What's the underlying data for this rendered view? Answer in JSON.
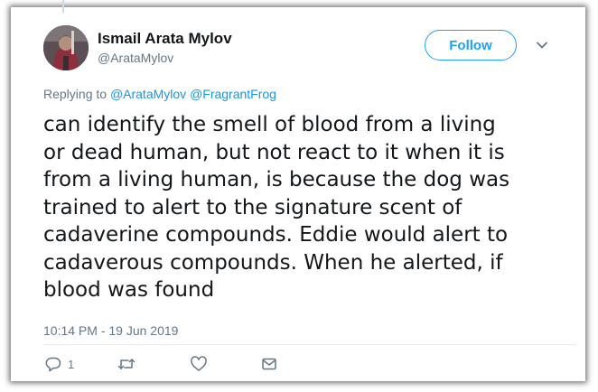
{
  "tweet": {
    "display_name": "Ismail Arata Mylov",
    "handle": "@ArataMylov",
    "follow_label": "Follow",
    "replying_prefix": "Replying to",
    "reply_mentions": [
      "@ArataMylov",
      "@FragrantFrog"
    ],
    "text_lines": [
      "can identify the smell of blood from a living",
      "or dead human, but not react to it when it is",
      "from a living human, is because the dog was",
      "trained to alert to the signature scent of",
      "cadaverine compounds. Eddie would alert to",
      "cadaverous compounds. When he alerted, if",
      "blood was found"
    ],
    "timestamp": "10:14 PM - 19 Jun 2019",
    "actions": {
      "reply_count": "1"
    }
  },
  "icons": {
    "caret": "chevron-down-icon",
    "reply": "reply-icon",
    "retweet": "retweet-icon",
    "like": "heart-icon",
    "dm": "envelope-icon"
  },
  "colors": {
    "accent": "#1da1f2",
    "link": "#1b95e0",
    "muted": "#657786",
    "text": "#14171a"
  }
}
